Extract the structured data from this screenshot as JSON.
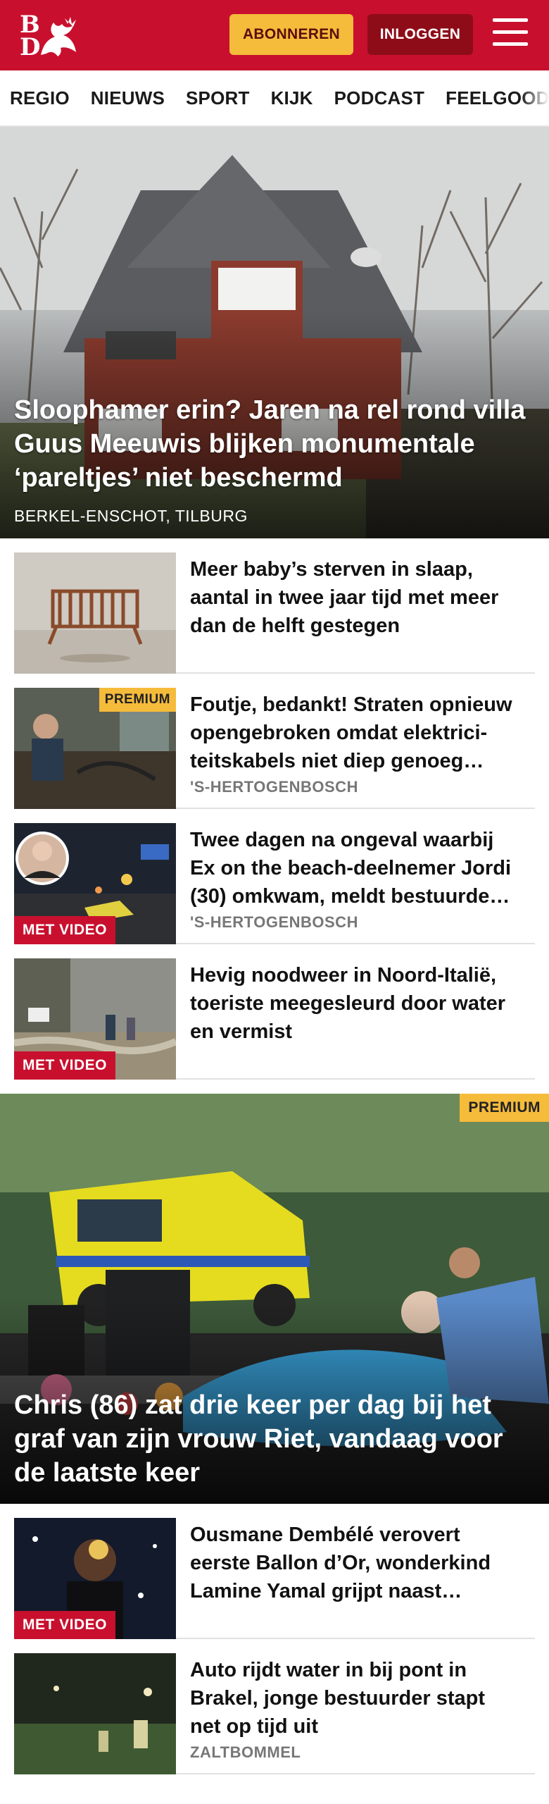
{
  "header": {
    "subscribe_label": "ABONNEREN",
    "login_label": "INLOGGEN",
    "logo_letters": [
      "B",
      "D"
    ],
    "brand_color": "#c8102e",
    "accent_color": "#f5bb3b"
  },
  "nav": {
    "items": [
      "REGIO",
      "NIEUWS",
      "SPORT",
      "KIJK",
      "PODCAST",
      "FEELGOOD"
    ]
  },
  "hero": {
    "title": "Sloophamer erin? Jaren na rel rond villa Guus Meeuwis blijken monumentale ‘pareltjes’ niet beschermd",
    "location": "BERKEL-ENSCHOT, TILBURG"
  },
  "articles": [
    {
      "title": "Meer baby’s sterven in slaap, aantal in twee jaar tijd met meer dan de helft gestegen",
      "location": "",
      "badge": ""
    },
    {
      "title": "Foutje, bedankt! Straten opnieuw opengebroken omdat elektrici­teitskabels niet diep genoeg…",
      "location": "'S-HERTOGENBOSCH",
      "badge": "PREMIUM"
    },
    {
      "title": "Twee dagen na ongeval waarbij Ex on the beach-deelnemer Jordi (30) omkwam, meldt bestuurde…",
      "location": "'S-HERTOGENBOSCH",
      "badge": "MET VIDEO"
    },
    {
      "title": "Hevig noodweer in Noord-Italië, toeriste meegesleurd door water en vermist",
      "location": "",
      "badge": "MET VIDEO"
    }
  ],
  "feature": {
    "title": "Chris (86) zat drie keer per dag bij het graf van zijn vrouw Riet, vandaag voor de laatste keer",
    "badge": "PREMIUM"
  },
  "articles2": [
    {
      "title": "Ousmane Dembélé verovert eerste Ballon d’Or, wonderkind Lamine Yamal grijpt naast…",
      "location": "",
      "badge": "MET VIDEO"
    },
    {
      "title": "Auto rijdt water in bij pont in Brakel, jonge bestuurder stapt net op tijd uit",
      "location": "ZALTBOMMEL",
      "badge": ""
    }
  ]
}
